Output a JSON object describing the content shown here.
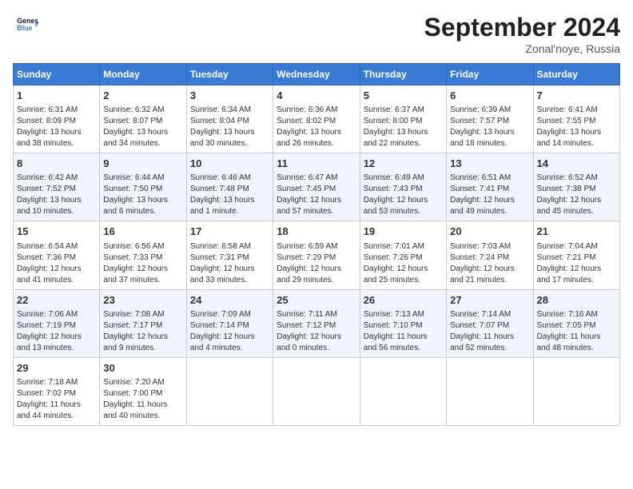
{
  "header": {
    "logo_line1": "General",
    "logo_line2": "Blue",
    "title": "September 2024",
    "subtitle": "Zonal'noye, Russia"
  },
  "weekdays": [
    "Sunday",
    "Monday",
    "Tuesday",
    "Wednesday",
    "Thursday",
    "Friday",
    "Saturday"
  ],
  "weeks": [
    [
      {
        "day": "1",
        "info": "Sunrise: 6:31 AM\nSunset: 8:09 PM\nDaylight: 13 hours\nand 38 minutes."
      },
      {
        "day": "2",
        "info": "Sunrise: 6:32 AM\nSunset: 8:07 PM\nDaylight: 13 hours\nand 34 minutes."
      },
      {
        "day": "3",
        "info": "Sunrise: 6:34 AM\nSunset: 8:04 PM\nDaylight: 13 hours\nand 30 minutes."
      },
      {
        "day": "4",
        "info": "Sunrise: 6:36 AM\nSunset: 8:02 PM\nDaylight: 13 hours\nand 26 minutes."
      },
      {
        "day": "5",
        "info": "Sunrise: 6:37 AM\nSunset: 8:00 PM\nDaylight: 13 hours\nand 22 minutes."
      },
      {
        "day": "6",
        "info": "Sunrise: 6:39 AM\nSunset: 7:57 PM\nDaylight: 13 hours\nand 18 minutes."
      },
      {
        "day": "7",
        "info": "Sunrise: 6:41 AM\nSunset: 7:55 PM\nDaylight: 13 hours\nand 14 minutes."
      }
    ],
    [
      {
        "day": "8",
        "info": "Sunrise: 6:42 AM\nSunset: 7:52 PM\nDaylight: 13 hours\nand 10 minutes."
      },
      {
        "day": "9",
        "info": "Sunrise: 6:44 AM\nSunset: 7:50 PM\nDaylight: 13 hours\nand 6 minutes."
      },
      {
        "day": "10",
        "info": "Sunrise: 6:46 AM\nSunset: 7:48 PM\nDaylight: 13 hours\nand 1 minute."
      },
      {
        "day": "11",
        "info": "Sunrise: 6:47 AM\nSunset: 7:45 PM\nDaylight: 12 hours\nand 57 minutes."
      },
      {
        "day": "12",
        "info": "Sunrise: 6:49 AM\nSunset: 7:43 PM\nDaylight: 12 hours\nand 53 minutes."
      },
      {
        "day": "13",
        "info": "Sunrise: 6:51 AM\nSunset: 7:41 PM\nDaylight: 12 hours\nand 49 minutes."
      },
      {
        "day": "14",
        "info": "Sunrise: 6:52 AM\nSunset: 7:38 PM\nDaylight: 12 hours\nand 45 minutes."
      }
    ],
    [
      {
        "day": "15",
        "info": "Sunrise: 6:54 AM\nSunset: 7:36 PM\nDaylight: 12 hours\nand 41 minutes."
      },
      {
        "day": "16",
        "info": "Sunrise: 6:56 AM\nSunset: 7:33 PM\nDaylight: 12 hours\nand 37 minutes."
      },
      {
        "day": "17",
        "info": "Sunrise: 6:58 AM\nSunset: 7:31 PM\nDaylight: 12 hours\nand 33 minutes."
      },
      {
        "day": "18",
        "info": "Sunrise: 6:59 AM\nSunset: 7:29 PM\nDaylight: 12 hours\nand 29 minutes."
      },
      {
        "day": "19",
        "info": "Sunrise: 7:01 AM\nSunset: 7:26 PM\nDaylight: 12 hours\nand 25 minutes."
      },
      {
        "day": "20",
        "info": "Sunrise: 7:03 AM\nSunset: 7:24 PM\nDaylight: 12 hours\nand 21 minutes."
      },
      {
        "day": "21",
        "info": "Sunrise: 7:04 AM\nSunset: 7:21 PM\nDaylight: 12 hours\nand 17 minutes."
      }
    ],
    [
      {
        "day": "22",
        "info": "Sunrise: 7:06 AM\nSunset: 7:19 PM\nDaylight: 12 hours\nand 13 minutes."
      },
      {
        "day": "23",
        "info": "Sunrise: 7:08 AM\nSunset: 7:17 PM\nDaylight: 12 hours\nand 9 minutes."
      },
      {
        "day": "24",
        "info": "Sunrise: 7:09 AM\nSunset: 7:14 PM\nDaylight: 12 hours\nand 4 minutes."
      },
      {
        "day": "25",
        "info": "Sunrise: 7:11 AM\nSunset: 7:12 PM\nDaylight: 12 hours\nand 0 minutes."
      },
      {
        "day": "26",
        "info": "Sunrise: 7:13 AM\nSunset: 7:10 PM\nDaylight: 11 hours\nand 56 minutes."
      },
      {
        "day": "27",
        "info": "Sunrise: 7:14 AM\nSunset: 7:07 PM\nDaylight: 11 hours\nand 52 minutes."
      },
      {
        "day": "28",
        "info": "Sunrise: 7:16 AM\nSunset: 7:05 PM\nDaylight: 11 hours\nand 48 minutes."
      }
    ],
    [
      {
        "day": "29",
        "info": "Sunrise: 7:18 AM\nSunset: 7:02 PM\nDaylight: 11 hours\nand 44 minutes."
      },
      {
        "day": "30",
        "info": "Sunrise: 7:20 AM\nSunset: 7:00 PM\nDaylight: 11 hours\nand 40 minutes."
      },
      {
        "day": "",
        "info": ""
      },
      {
        "day": "",
        "info": ""
      },
      {
        "day": "",
        "info": ""
      },
      {
        "day": "",
        "info": ""
      },
      {
        "day": "",
        "info": ""
      }
    ]
  ]
}
